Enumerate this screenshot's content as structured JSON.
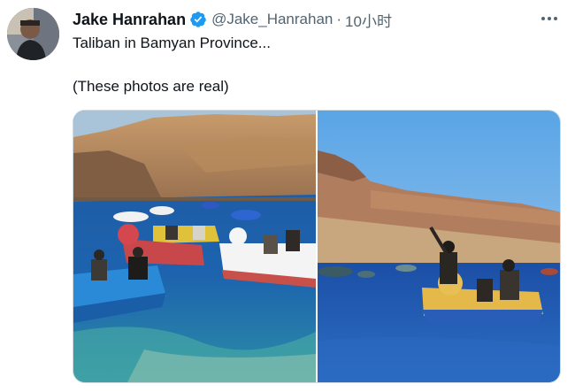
{
  "tweet": {
    "display_name": "Jake Hanrahan",
    "handle": "@Jake_Hanrahan",
    "separator": "·",
    "time": "10小时",
    "text_line1": "Taliban in Bamyan Province...",
    "text_line2": "(These photos are real)"
  },
  "icons": {
    "verified": "verified-badge-icon",
    "more": "more-options-icon"
  },
  "colors": {
    "verified_blue": "#1d9bf0",
    "secondary_text": "#536471",
    "primary_text": "#0f1419"
  },
  "media": {
    "photos": [
      "photo-1",
      "photo-2"
    ]
  }
}
